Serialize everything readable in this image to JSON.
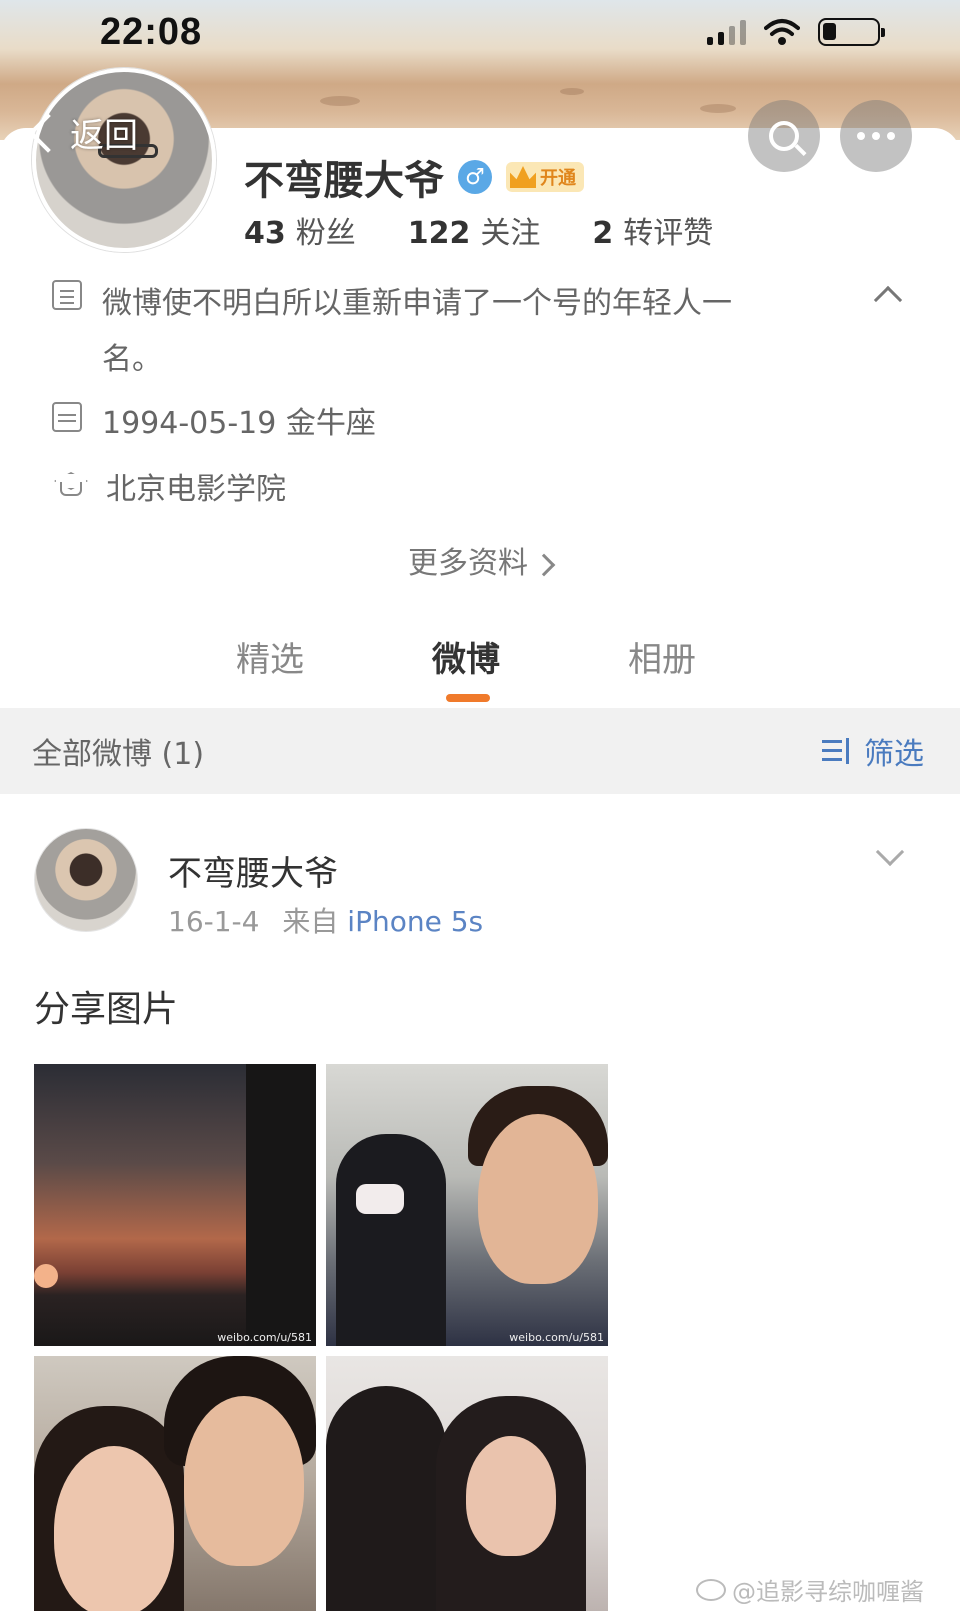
{
  "status_bar": {
    "time": "22:08"
  },
  "header": {
    "back_label": "返回"
  },
  "profile": {
    "name": "不弯腰大爷",
    "gender_symbol": "♂",
    "vip_label": "开通",
    "stats": [
      {
        "value": "43",
        "label": "粉丝"
      },
      {
        "value": "122",
        "label": "关注"
      },
      {
        "value": "2",
        "label": "转评赞"
      }
    ],
    "bio": "微博使不明白所以重新申请了一个号的年轻人一名。",
    "birthday": "1994-05-19 金牛座",
    "school": "北京电影学院",
    "more_info": "更多资料"
  },
  "tabs": [
    {
      "label": "精选",
      "active": false
    },
    {
      "label": "微博",
      "active": true
    },
    {
      "label": "相册",
      "active": false
    }
  ],
  "filter_bar": {
    "title": "全部微博 (1)",
    "filter_label": "筛选"
  },
  "post": {
    "author": "不弯腰大爷",
    "date": "16-1-4",
    "source_prefix": "来自",
    "source": "iPhone 5s",
    "text": "分享图片",
    "photo_watermarks": [
      "weibo.com/u/581",
      "weibo.com/u/581"
    ]
  },
  "page_watermark": "@追影寻综咖喱酱",
  "colors": {
    "accent_orange": "#f07a2b",
    "link_blue": "#5b84c4",
    "filter_blue": "#4a7bbf"
  }
}
